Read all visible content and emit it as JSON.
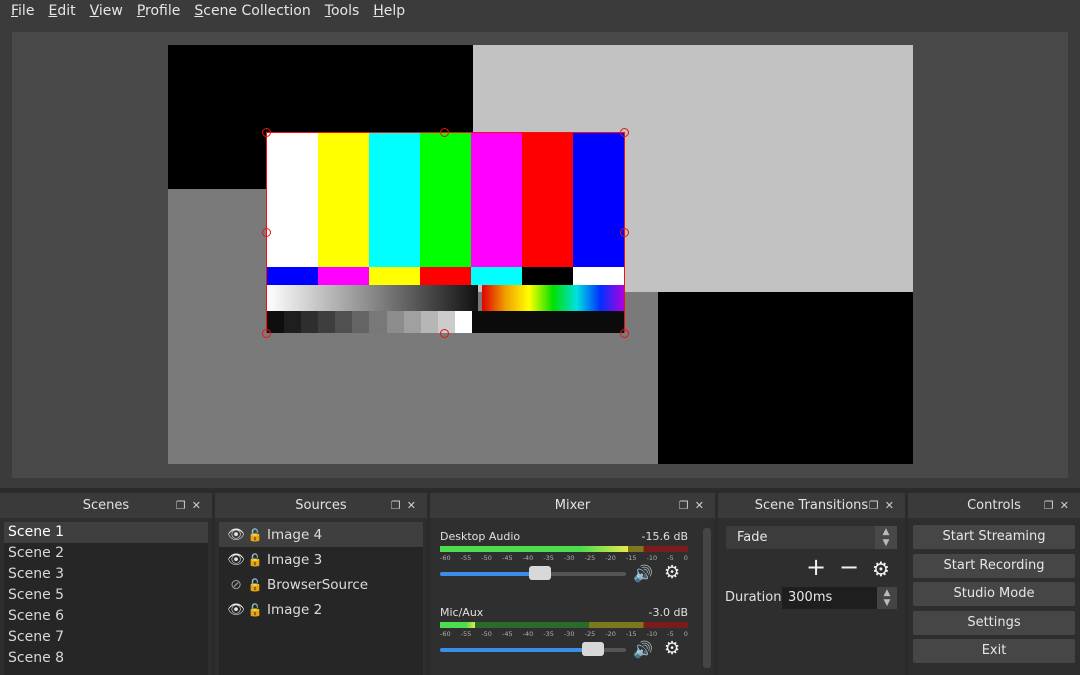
{
  "menu": [
    "File",
    "Edit",
    "View",
    "Profile",
    "Scene Collection",
    "Tools",
    "Help"
  ],
  "menu_underline": [
    "F",
    "E",
    "V",
    "P",
    "S",
    "T",
    "H"
  ],
  "menu_rest": [
    "ile",
    "dit",
    "iew",
    "rofile",
    "cene Collection",
    "ools",
    "elp"
  ],
  "docks": {
    "scenes": {
      "title": "Scenes",
      "items": [
        "Scene 1",
        "Scene 2",
        "Scene 3",
        "Scene 5",
        "Scene 6",
        "Scene 7",
        "Scene 8"
      ],
      "active_index": 0
    },
    "sources": {
      "title": "Sources",
      "items": [
        {
          "label": "Image 4",
          "visible": true
        },
        {
          "label": "Image 3",
          "visible": true
        },
        {
          "label": "BrowserSource",
          "visible": false
        },
        {
          "label": "Image 2",
          "visible": true
        }
      ]
    },
    "mixer": {
      "title": "Mixer",
      "channels": [
        {
          "name": "Desktop Audio",
          "db": "-15.6 dB",
          "level": 0.76,
          "volume": 0.54
        },
        {
          "name": "Mic/Aux",
          "db": "-3.0 dB",
          "level": 0.14,
          "volume": 0.82
        }
      ],
      "ticks": [
        "-60",
        "-55",
        "-50",
        "-45",
        "-40",
        "-35",
        "-30",
        "-25",
        "-20",
        "-15",
        "-10",
        "-5",
        "0"
      ]
    },
    "transitions": {
      "title": "Scene Transitions",
      "selected": "Fade",
      "duration_label": "Duration",
      "duration_value": "300ms"
    },
    "controls": {
      "title": "Controls",
      "buttons": [
        "Start Streaming",
        "Start Recording",
        "Studio Mode",
        "Settings",
        "Exit"
      ]
    }
  },
  "colors": {
    "bars_top": [
      "#ffffff",
      "#ffff00",
      "#00ffff",
      "#00ff00",
      "#ff00ff",
      "#ff0000",
      "#0000ff"
    ],
    "bars_mid": [
      "#0000ff",
      "#ff00ff",
      "#ffff00",
      "#ff0000",
      "#00ffff",
      "#000000",
      "#ffffff"
    ],
    "gray_steps": [
      "#0e0e0e",
      "#1e1e1e",
      "#2e2e2e",
      "#3e3e3e",
      "#505050",
      "#646464",
      "#787878",
      "#8c8c8c",
      "#a0a0a0",
      "#b6b6b6",
      "#cccccc",
      "#ffffff"
    ],
    "selection": "#ee1111",
    "accent": "#3b8ee6"
  },
  "icons": {
    "visible": "eye-icon",
    "hidden": "eye-crossed-icon",
    "lock": "lock-icon",
    "add": "plus-icon",
    "remove": "minus-icon",
    "settings": "gear-icon",
    "speaker": "speaker-icon"
  }
}
